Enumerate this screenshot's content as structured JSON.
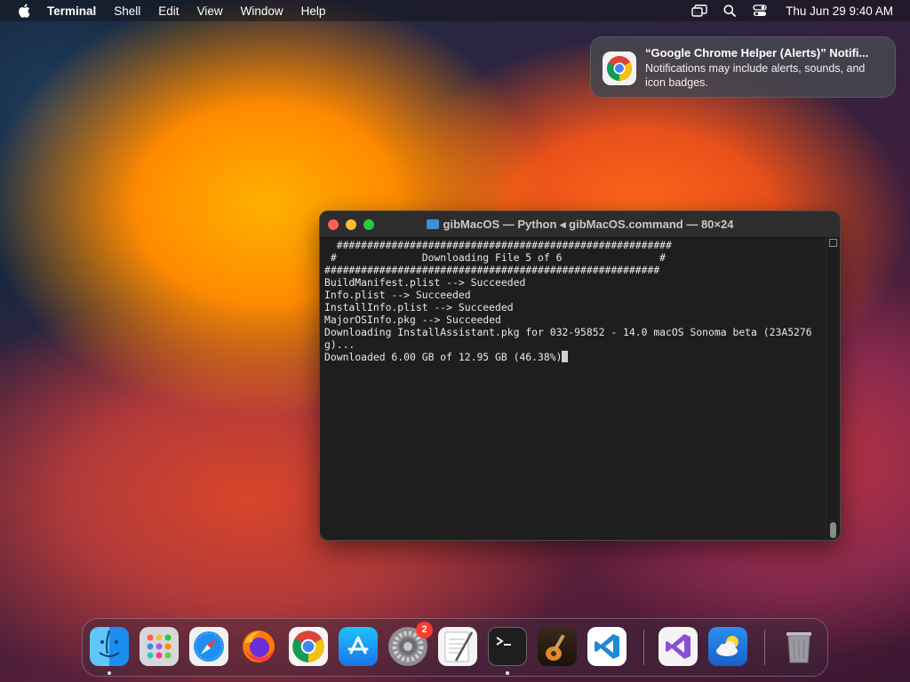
{
  "menubar": {
    "app_name": "Terminal",
    "items": [
      "Shell",
      "Edit",
      "View",
      "Window",
      "Help"
    ],
    "clock": "Thu Jun 29  9:40 AM"
  },
  "notification": {
    "title": "“Google Chrome Helper (Alerts)” Notifi...",
    "body": "Notifications may include alerts, sounds, and icon badges.",
    "icon": "chrome-icon"
  },
  "terminal": {
    "title": "gibMacOS — Python ◂ gibMacOS.command — 80×24",
    "lines": [
      "  #######################################################",
      " #              Downloading File 5 of 6                #",
      "#######################################################",
      "",
      "BuildManifest.plist --> Succeeded",
      "Info.plist --> Succeeded",
      "InstallInfo.plist --> Succeeded",
      "MajorOSInfo.pkg --> Succeeded",
      "",
      "Downloading InstallAssistant.pkg for 032-95852 - 14.0 macOS Sonoma beta (23A5276",
      "g)...",
      "",
      "Downloaded 6.00 GB of 12.95 GB (46.38%)"
    ]
  },
  "dock": {
    "apps": [
      "finder",
      "launchpad",
      "safari",
      "firefox",
      "chrome",
      "app-store",
      "system-settings",
      "textedit",
      "terminal",
      "garageband",
      "vscode",
      "visual-studio",
      "weather",
      "trash"
    ],
    "settings_badge": "2"
  },
  "colors": {
    "terminal_bg": "#1e1e1e",
    "close": "#ff5f57",
    "minimize": "#febc2e",
    "maximize": "#28c840",
    "badge": "#ff3b30"
  }
}
